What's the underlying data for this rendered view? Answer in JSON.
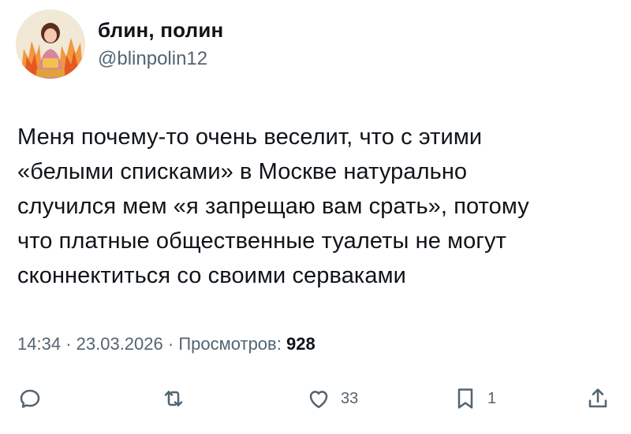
{
  "author": {
    "display_name": "блин, полин",
    "handle": "@blinpolin12"
  },
  "tweet": {
    "lines": [
      "Меня почему-то очень веселит, что с этими",
      "«белыми списками» в Москве натурально",
      "случился мем «я запрещаю вам срать», потому",
      "что платные общественные туалеты не могут",
      "сконнектиться со своими серваками"
    ]
  },
  "meta": {
    "time": "14:34",
    "separator": "·",
    "date": "23.03.2026",
    "views_label": "Просмотров:",
    "views_count": "928"
  },
  "actions": {
    "reply_icon": "reply-bubble",
    "retweet_icon": "retweet-arrows",
    "like_icon": "heart-outline",
    "like_count": "33",
    "bookmark_icon": "bookmark-outline",
    "bookmark_count": "1",
    "share_icon": "share-upload",
    "icon_color": "#536471"
  }
}
